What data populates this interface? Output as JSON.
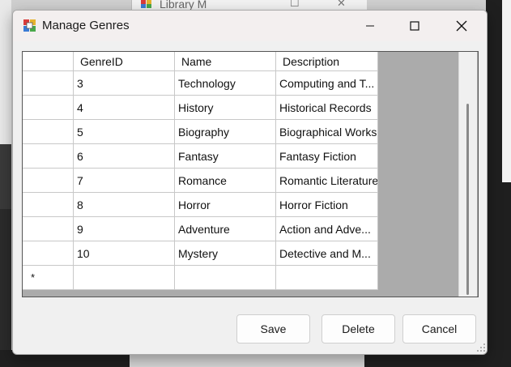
{
  "background": {
    "window_title": "Library M"
  },
  "dialog": {
    "title": "Manage Genres",
    "buttons": {
      "save": "Save",
      "delete": "Delete",
      "cancel": "Cancel"
    }
  },
  "grid": {
    "columns": [
      "GenreID",
      "Name",
      "Description"
    ],
    "rows": [
      [
        "3",
        "Technology",
        "Computing and T..."
      ],
      [
        "4",
        "History",
        "Historical Records"
      ],
      [
        "5",
        "Biography",
        "Biographical Works"
      ],
      [
        "6",
        "Fantasy",
        "Fantasy Fiction"
      ],
      [
        "7",
        "Romance",
        "Romantic Literature"
      ],
      [
        "8",
        "Horror",
        "Horror Fiction"
      ],
      [
        "9",
        "Adventure",
        "Action and Adve..."
      ],
      [
        "10",
        "Mystery",
        "Detective and M..."
      ]
    ],
    "new_row_marker": "*"
  },
  "icons": {
    "app": "app-icon",
    "minimize": "minimize-icon",
    "maximize": "maximize-icon",
    "close": "close-icon"
  },
  "colors": {
    "grid_background": "#ababab",
    "dialog_background": "#f0f0f0",
    "titlebar": "#f3efef"
  }
}
